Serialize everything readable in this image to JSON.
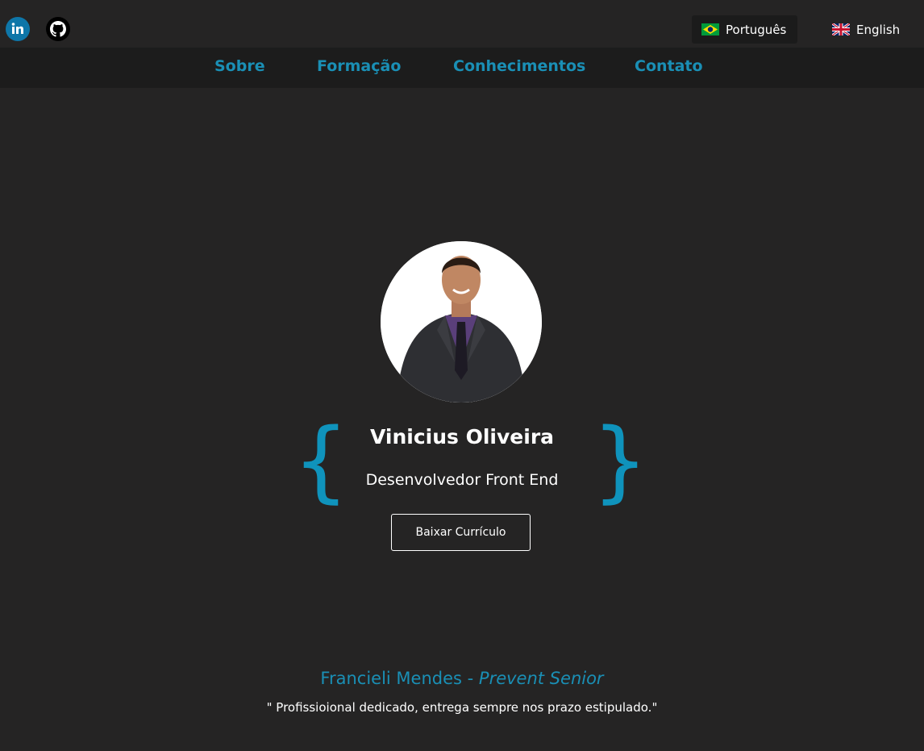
{
  "social": {
    "linkedin_icon": "linkedin-icon",
    "github_icon": "github-icon"
  },
  "languages": [
    {
      "label": "Português",
      "flag": "brazil-flag-icon"
    },
    {
      "label": "English",
      "flag": "uk-flag-icon"
    }
  ],
  "nav": {
    "items": [
      "Sobre",
      "Formação",
      "Conhecimentos",
      "Contato"
    ]
  },
  "hero": {
    "name": "Vinicius Oliveira",
    "role": "Desenvolvedor Front End",
    "button_label": "Baixar Currículo",
    "brace_left": "{",
    "brace_right": "}"
  },
  "testimonial": {
    "author": "Francieli Mendes - ",
    "company": "Prevent Senior",
    "quote": "\" Profissioional dedicado, entrega sempre nos prazo estipulado.\""
  },
  "colors": {
    "background": "#252424",
    "navbar": "#1c1c1c",
    "accent": "#1a8fb5",
    "text": "#ffffff"
  }
}
